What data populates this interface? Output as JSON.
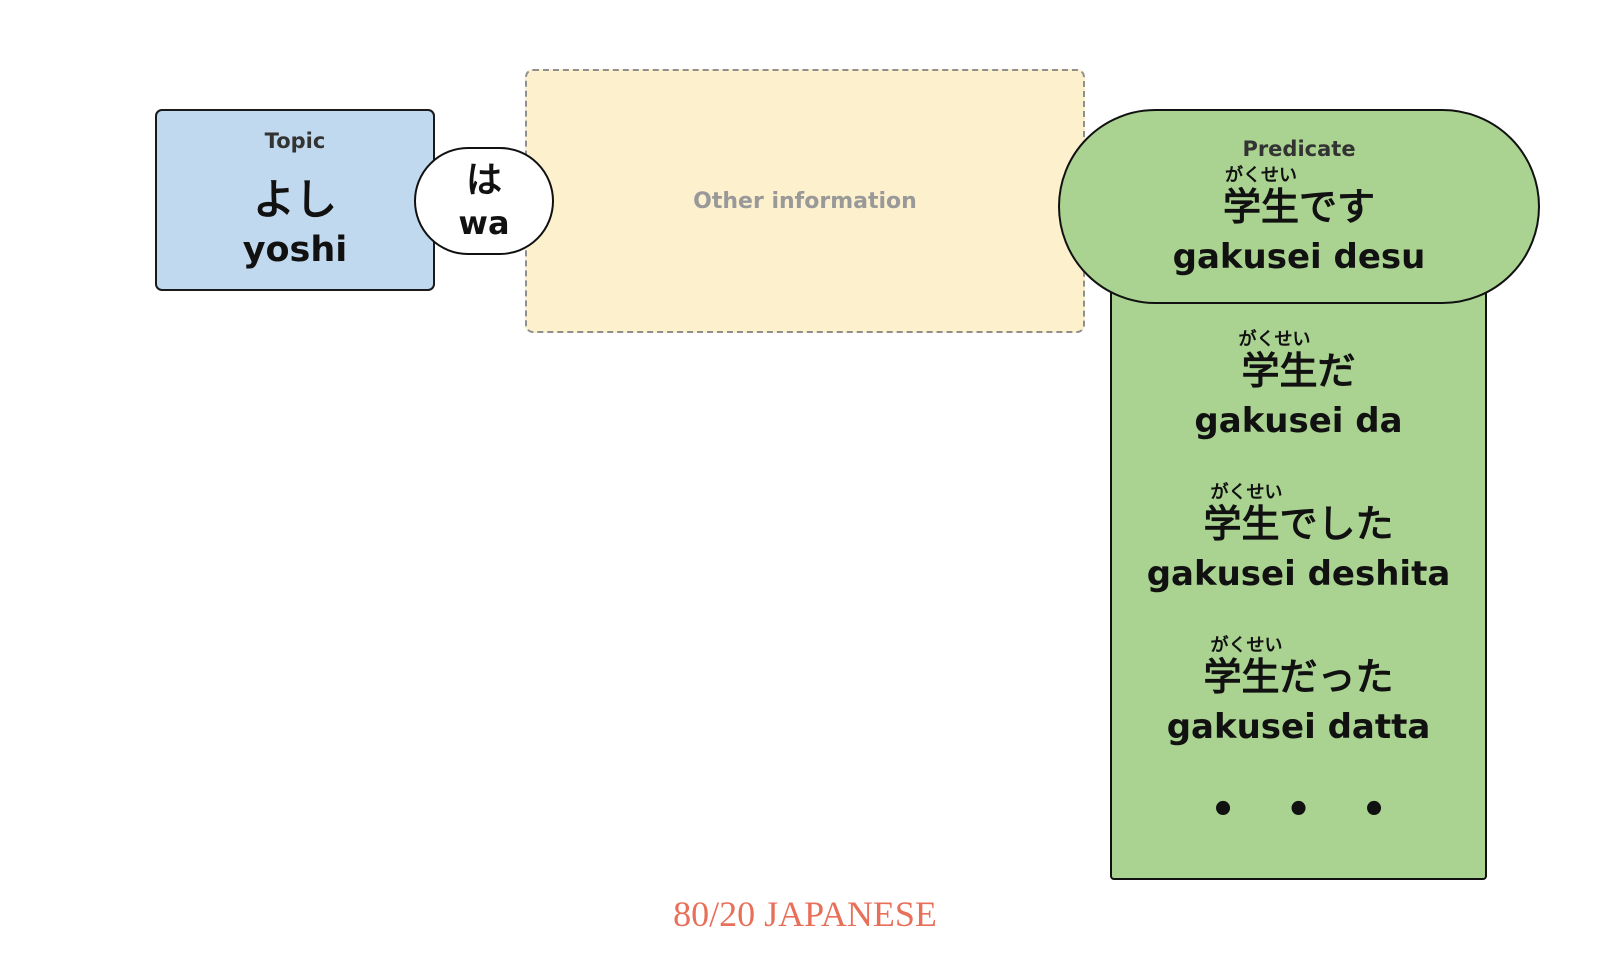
{
  "topic": {
    "label": "Topic",
    "kana": "よし",
    "romaji": "yoshi"
  },
  "particle": {
    "kana": "は",
    "romaji": "wa"
  },
  "other": {
    "label": "Other information"
  },
  "predicate": {
    "label": "Predicate",
    "main": {
      "furigana": "がくせい",
      "kanji": "学生です",
      "romaji": "gakusei desu"
    },
    "forms": [
      {
        "furigana": "がくせい",
        "kanji": "学生だ",
        "romaji": "gakusei da"
      },
      {
        "furigana": "がくせい",
        "kanji": "学生でした",
        "romaji": "gakusei deshita"
      },
      {
        "furigana": "がくせい",
        "kanji": "学生だった",
        "romaji": "gakusei datta"
      }
    ],
    "more": "• • •"
  },
  "brand": {
    "text": "80/20 JAPANESE",
    "color": "#e8705a"
  },
  "colors": {
    "topic_fill": "#c0d9ee",
    "other_fill": "#fdf0cd",
    "predicate_fill": "#aad391"
  }
}
